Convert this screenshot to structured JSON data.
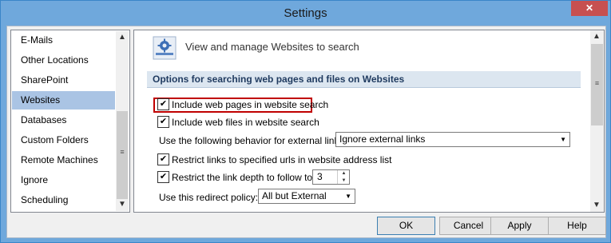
{
  "window": {
    "title": "Settings",
    "close_glyph": "✕"
  },
  "sidebar": {
    "items": [
      {
        "label": "E-Mails",
        "selected": false
      },
      {
        "label": "Other Locations",
        "selected": false
      },
      {
        "label": "SharePoint",
        "selected": false
      },
      {
        "label": "Websites",
        "selected": true
      },
      {
        "label": "Databases",
        "selected": false
      },
      {
        "label": "Custom Folders",
        "selected": false
      },
      {
        "label": "Remote Machines",
        "selected": false
      },
      {
        "label": "Ignore",
        "selected": false
      },
      {
        "label": "Scheduling",
        "selected": false
      }
    ]
  },
  "main": {
    "icon": "gear-icon",
    "header": "View and manage Websites to search",
    "section_title": "Options for searching web pages and files on Websites",
    "options": {
      "include_pages": {
        "label": "Include web pages in website search",
        "checked": true
      },
      "include_files": {
        "label": "Include web files in website search",
        "checked": true
      },
      "external_links_label": "Use the following behavior for external links:",
      "external_links_value": "Ignore external links",
      "restrict_urls": {
        "label": "Restrict links to specified urls in website address list",
        "checked": true
      },
      "restrict_depth": {
        "label": "Restrict the link depth to follow to:",
        "checked": true
      },
      "depth_value": "3",
      "redirect_label": "Use this redirect policy:",
      "redirect_value": "All but External"
    }
  },
  "buttons": {
    "ok": "OK",
    "cancel": "Cancel",
    "apply": "Apply",
    "help": "Help"
  },
  "colors": {
    "selection": "#aac4e4",
    "highlight_border": "#c00000",
    "title_bar": "#6fa8dc",
    "section_header": "#dce6f0"
  }
}
